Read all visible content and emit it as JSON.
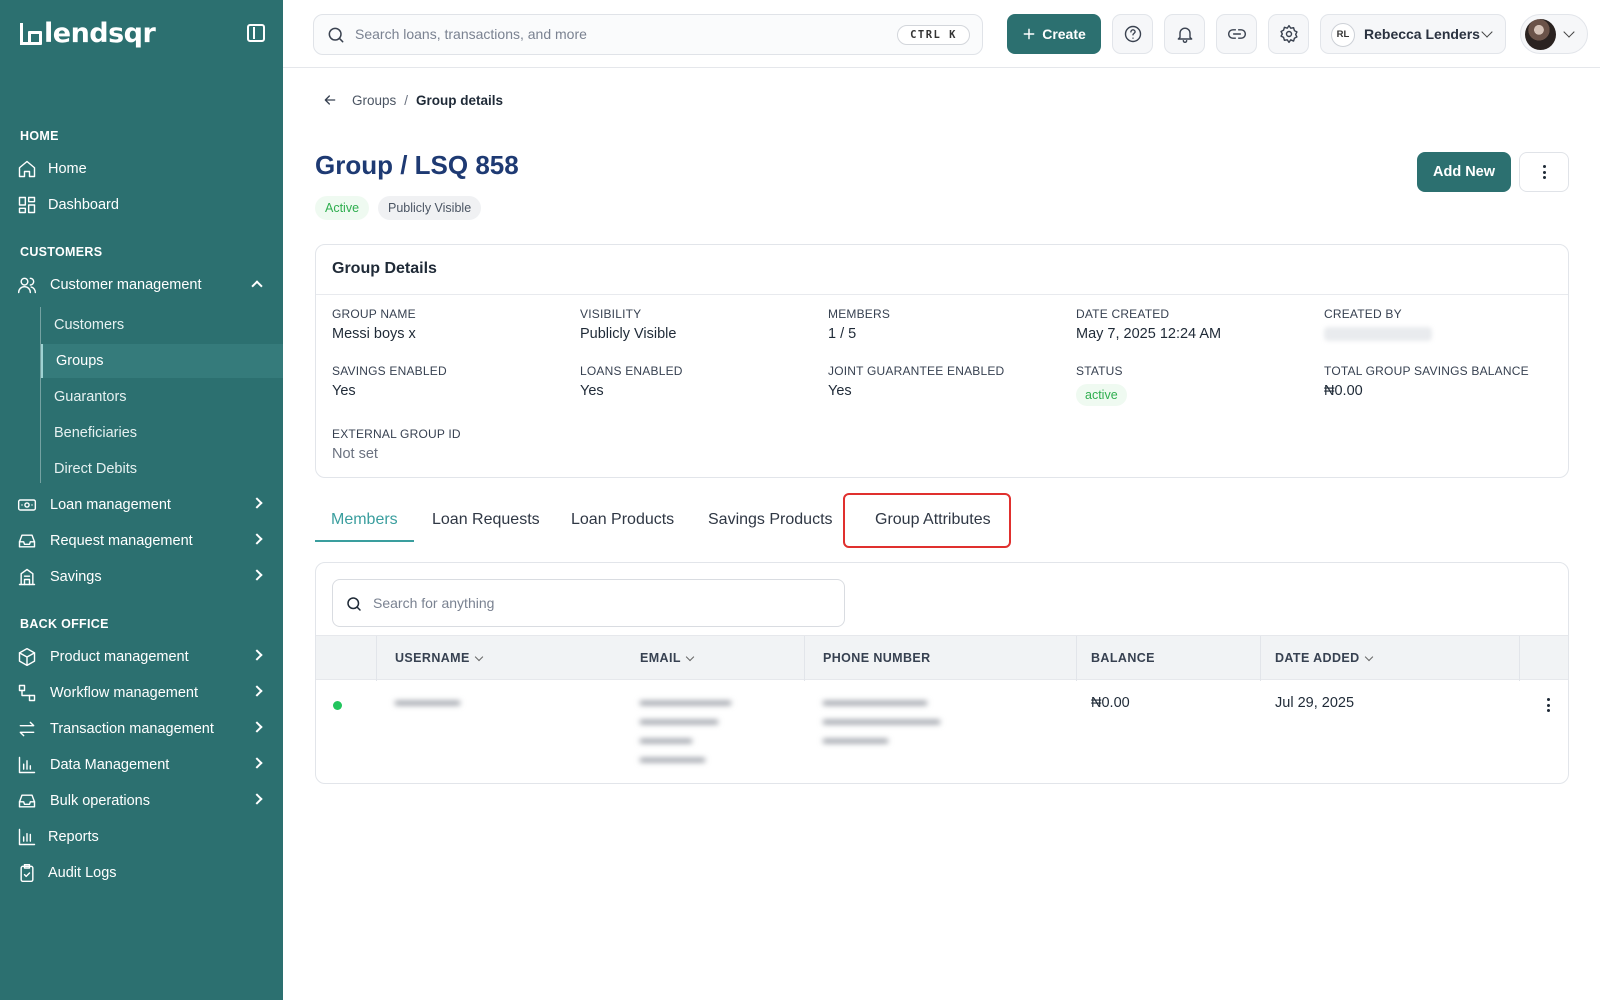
{
  "app": {
    "brand": "lendsqr"
  },
  "sidebar": {
    "sections": {
      "home": "HOME",
      "customers": "CUSTOMERS",
      "back_office": "BACK OFFICE"
    },
    "items": {
      "home": "Home",
      "dashboard": "Dashboard",
      "customer_management": "Customer management",
      "loan_management": "Loan management",
      "request_management": "Request management",
      "savings": "Savings",
      "product_management": "Product management",
      "workflow_management": "Workflow management",
      "transaction_management": "Transaction management",
      "data_management": "Data Management",
      "bulk_operations": "Bulk operations",
      "reports": "Reports",
      "audit_logs": "Audit Logs"
    },
    "sub_items": [
      "Customers",
      "Groups",
      "Guarantors",
      "Beneficiaries",
      "Direct Debits"
    ],
    "active_sub_item": "Groups"
  },
  "header": {
    "search_placeholder": "Search loans, transactions, and more",
    "shortcut": "CTRL K",
    "create_label": "Create",
    "user_initials": "RL",
    "user_name": "Rebecca Lenders"
  },
  "breadcrumb": {
    "parent": "Groups",
    "separator": "/",
    "current": "Group details"
  },
  "page": {
    "title": "Group / LSQ 858",
    "badges": {
      "status": "Active",
      "visibility": "Publicly Visible"
    },
    "add_new_label": "Add New"
  },
  "details": {
    "heading": "Group Details",
    "fields": {
      "group_name": {
        "label": "GROUP NAME",
        "value": "Messi boys x"
      },
      "visibility": {
        "label": "VISIBILITY",
        "value": "Publicly Visible"
      },
      "members": {
        "label": "MEMBERS",
        "value": "1 / 5"
      },
      "date_created": {
        "label": "DATE CREATED",
        "value": "May 7, 2025 12:24 AM"
      },
      "created_by": {
        "label": "CREATED BY"
      },
      "savings_enabled": {
        "label": "SAVINGS ENABLED",
        "value": "Yes"
      },
      "loans_enabled": {
        "label": "LOANS ENABLED",
        "value": "Yes"
      },
      "joint_guarantee": {
        "label": "JOINT GUARANTEE ENABLED",
        "value": "Yes"
      },
      "status": {
        "label": "STATUS",
        "value": "active"
      },
      "total_savings": {
        "label": "TOTAL GROUP SAVINGS BALANCE",
        "value": "₦0.00"
      },
      "external_id": {
        "label": "EXTERNAL GROUP ID",
        "value": "Not set"
      }
    }
  },
  "tabs": {
    "members": "Members",
    "loan_requests": "Loan Requests",
    "loan_products": "Loan Products",
    "savings_products": "Savings Products",
    "group_attributes": "Group Attributes",
    "active": "Members",
    "highlighted": "Group Attributes"
  },
  "members_table": {
    "search_placeholder": "Search for anything",
    "columns": {
      "username": "USERNAME",
      "email": "EMAIL",
      "phone": "PHONE NUMBER",
      "balance": "BALANCE",
      "date_added": "DATE ADDED"
    },
    "rows": [
      {
        "balance": "₦0.00",
        "date_added": "Jul 29, 2025"
      }
    ]
  },
  "colors": {
    "sidebar_bg": "#2c7070",
    "primary_button": "#2c7070",
    "title": "#1e3a73",
    "active_tab": "#3a9e9e",
    "success": "#2fae4f",
    "highlight_border": "#e0302e"
  }
}
